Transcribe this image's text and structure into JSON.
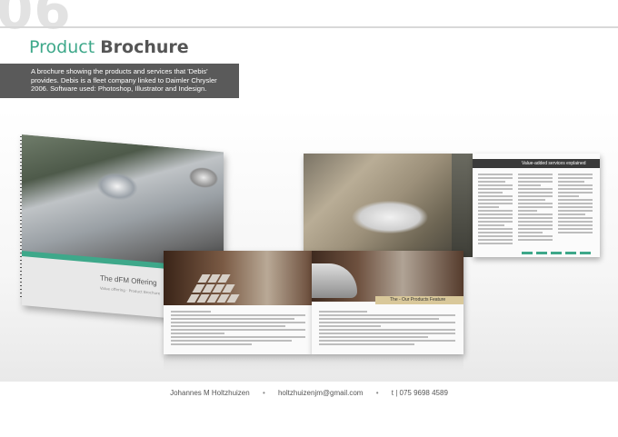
{
  "header": {
    "page_number": "06",
    "title_first": "Product",
    "title_second": "Brochure",
    "description": "A brochure showing the products and services that 'Debis' provides. Debis is a fleet company linked to Daimler Chrysler 2006. Software used: Photoshop, Illustrator and Indesign."
  },
  "cover": {
    "title": "The dFM Offering",
    "subtitle": "Value offering · Product Brochure"
  },
  "center_brochure": {
    "band_label": "The - Our Products Feature"
  },
  "right_brochure": {
    "band_label": "Value-added services explained"
  },
  "footer": {
    "name": "Johannes M Holtzhuizen",
    "email": "holtzhuizenjm@gmail.com",
    "phone": "t | 075 9698 4589",
    "separator": "•"
  },
  "colors": {
    "accent_green": "#3ea88a",
    "dark_band": "#5a5a5a"
  }
}
